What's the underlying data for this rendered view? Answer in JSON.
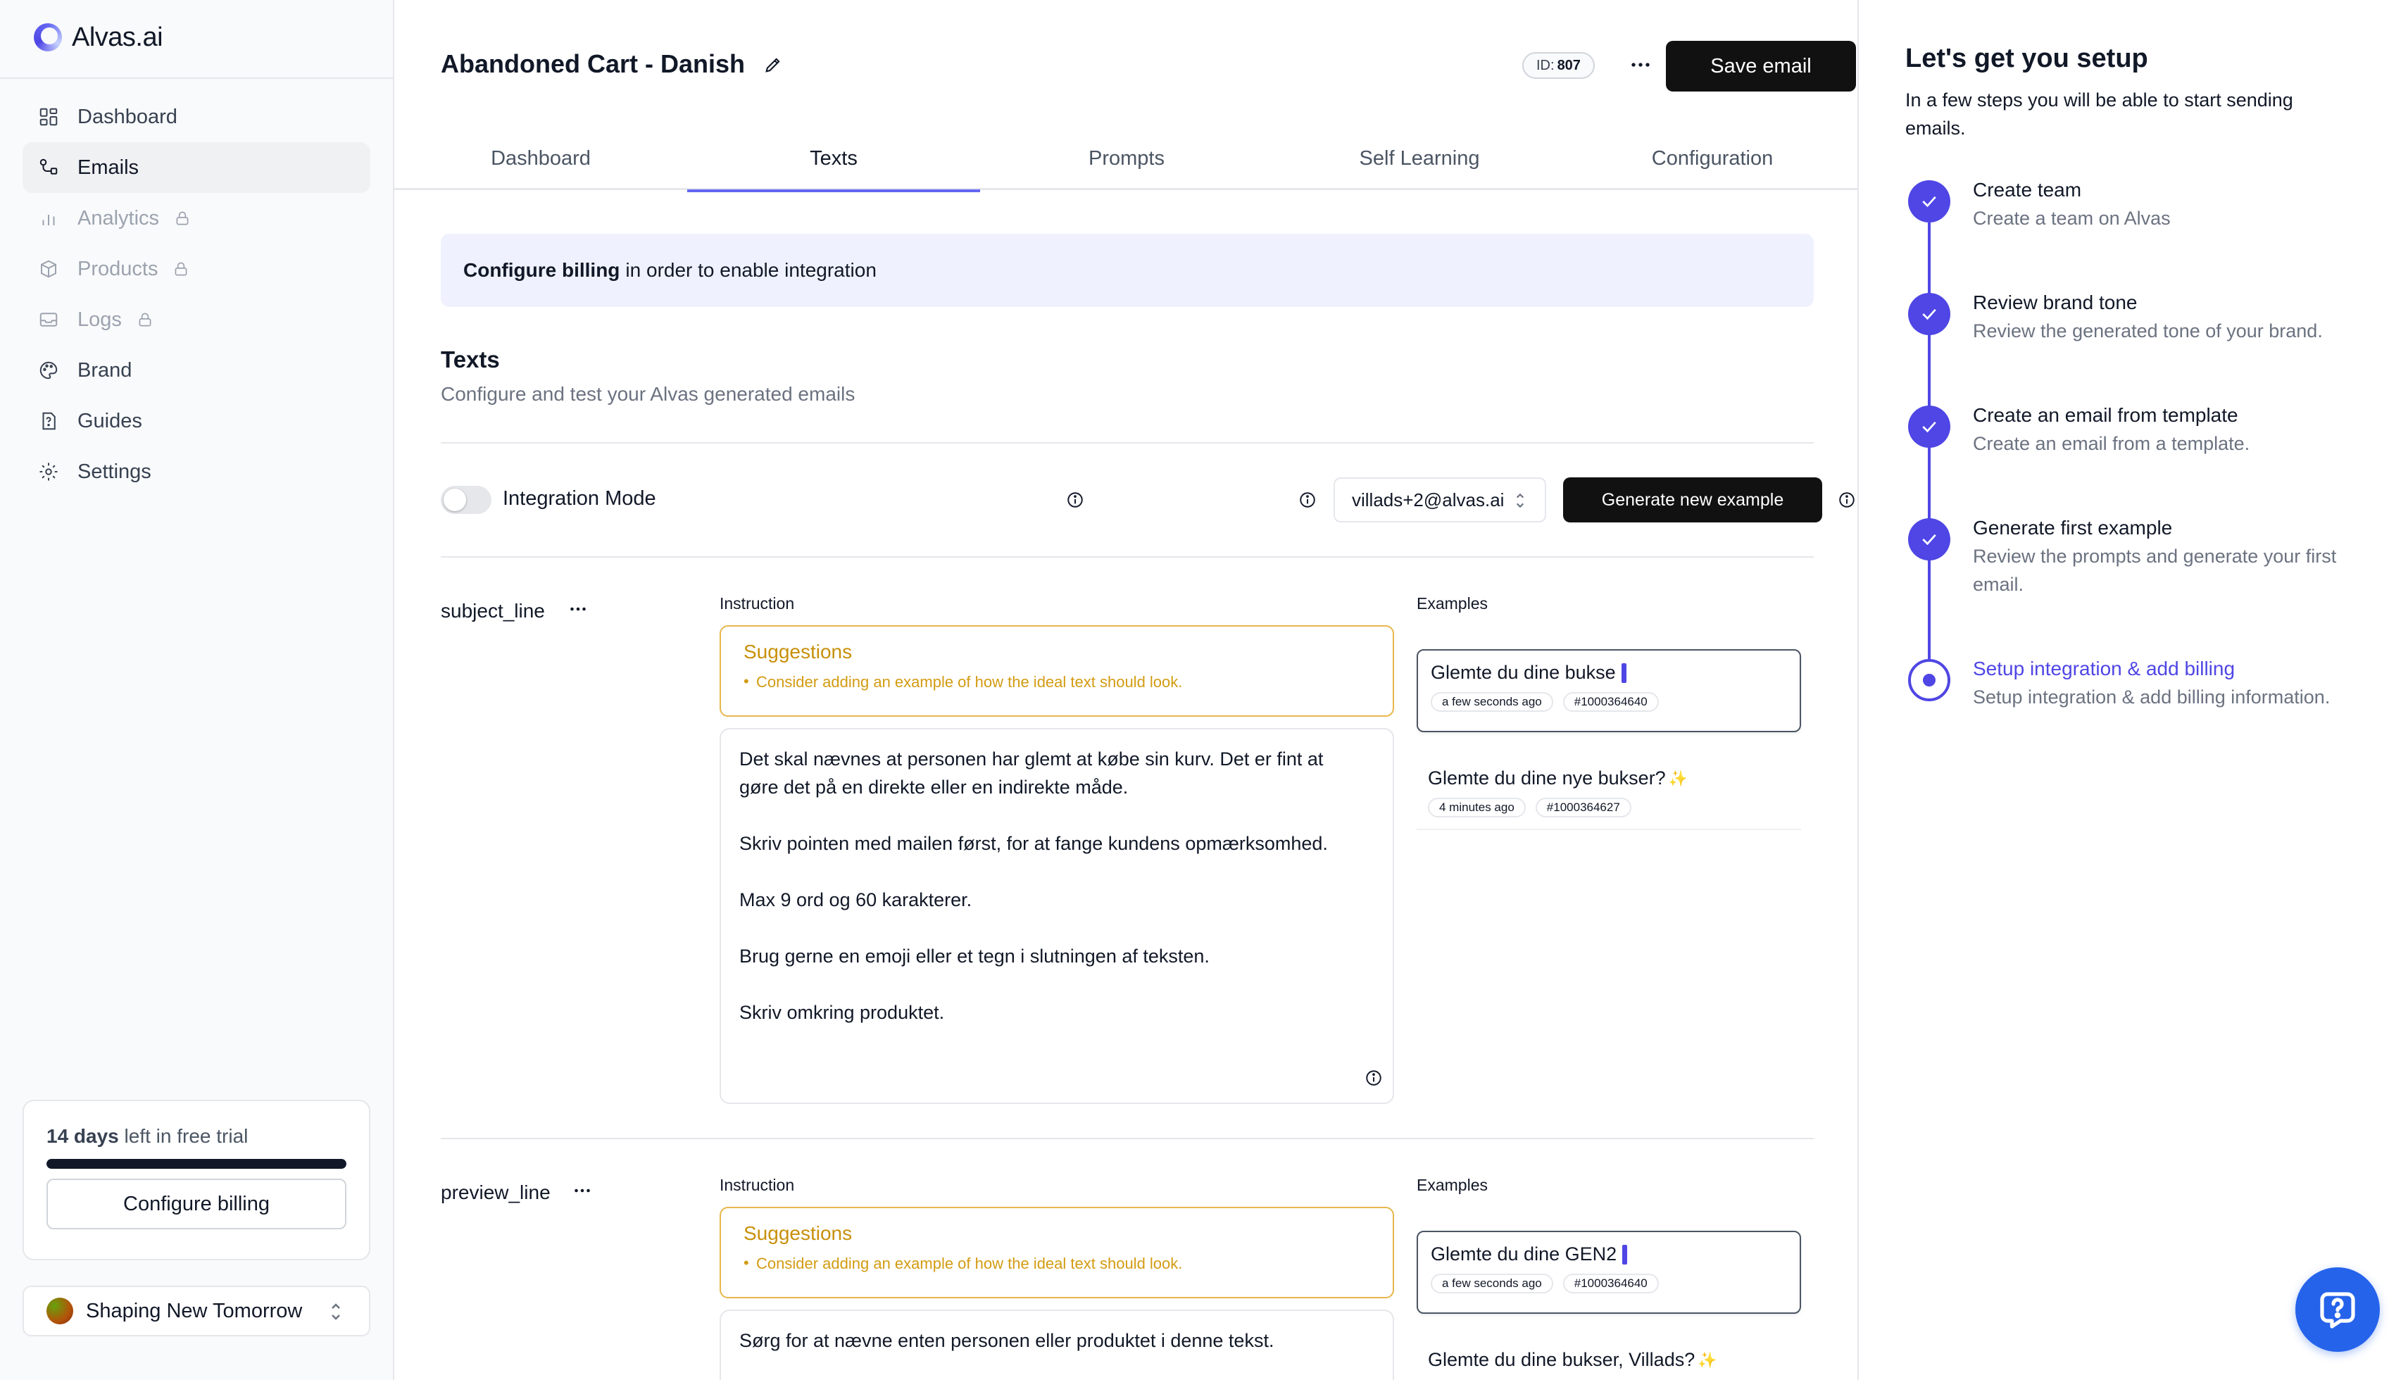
{
  "app": {
    "logo_text": "Alvas.ai"
  },
  "sidebar": {
    "items": [
      {
        "label": "Dashboard",
        "icon": "dashboard-grid-icon",
        "active": false,
        "locked": false
      },
      {
        "label": "Emails",
        "icon": "emails-icon",
        "active": true,
        "locked": false
      },
      {
        "label": "Analytics",
        "icon": "analytics-icon",
        "active": false,
        "locked": true
      },
      {
        "label": "Products",
        "icon": "products-icon",
        "active": false,
        "locked": true
      },
      {
        "label": "Logs",
        "icon": "logs-icon",
        "active": false,
        "locked": true
      },
      {
        "label": "Brand",
        "icon": "palette-icon",
        "active": false,
        "locked": false
      },
      {
        "label": "Guides",
        "icon": "guides-icon",
        "active": false,
        "locked": false
      },
      {
        "label": "Settings",
        "icon": "gear-icon",
        "active": false,
        "locked": false
      }
    ],
    "trial": {
      "days": "14 days",
      "suffix": "left in free trial",
      "progress": 1.0,
      "button": "Configure billing"
    },
    "team": {
      "name": "Shaping New Tomorrow"
    }
  },
  "header": {
    "title": "Abandoned Cart - Danish",
    "id_label": "ID:",
    "id_value": "807",
    "save_label": "Save email"
  },
  "tabs": [
    {
      "label": "Dashboard",
      "active": false
    },
    {
      "label": "Texts",
      "active": true
    },
    {
      "label": "Prompts",
      "active": false
    },
    {
      "label": "Self Learning",
      "active": false
    },
    {
      "label": "Configuration",
      "active": false
    }
  ],
  "banner": {
    "bold": "Configure billing",
    "rest": "in order to enable integration"
  },
  "texts_section": {
    "title": "Texts",
    "subtitle": "Configure and test your Alvas generated emails",
    "integration_label": "Integration Mode",
    "integration_on": false,
    "email_select": "villads+2@alvas.ai",
    "generate_label": "Generate new example",
    "instruction_label": "Instruction",
    "examples_label": "Examples",
    "suggestions_title": "Suggestions",
    "suggestion_item": "Consider adding an example of how the ideal text should look."
  },
  "fields": [
    {
      "name": "subject_line",
      "instruction_lines": [
        "Det skal nævnes at personen har glemt at købe sin kurv. Det er fint at",
        "gøre det på en direkte eller en indirekte måde.",
        "Skriv pointen med mailen først, for at fange kundens opmærksomhed.",
        "Max 9 ord og 60 karakterer.",
        "Brug gerne en emoji eller et tegn i slutningen af teksten.",
        "Skriv omkring produktet."
      ],
      "examples": [
        {
          "text": "Glemte du dine bukse",
          "time": "a few seconds ago",
          "id": "#1000364640"
        },
        {
          "text": "Glemte du dine nye bukser?",
          "time": "4 minutes ago",
          "id": "#1000364627"
        }
      ]
    },
    {
      "name": "preview_line",
      "instruction_lines": [
        "Sørg for at nævne enten personen eller produktet i denne tekst."
      ],
      "examples": [
        {
          "text": "Glemte du dine GEN2",
          "time": "a few seconds ago",
          "id": "#1000364640"
        },
        {
          "text": "Glemte du dine bukser, Villads?"
        }
      ]
    }
  ],
  "setup": {
    "title": "Let's get you setup",
    "subtitle": "In a few steps you will be able to start sending emails.",
    "steps": [
      {
        "title": "Create team",
        "desc": "Create a team on Alvas",
        "done": true
      },
      {
        "title": "Review brand tone",
        "desc": "Review the generated tone of your brand.",
        "done": true
      },
      {
        "title": "Create an email from template",
        "desc": "Create an email from a template.",
        "done": true
      },
      {
        "title": "Generate first example",
        "desc": "Review the prompts and generate your first email.",
        "done": true
      },
      {
        "title": "Setup integration & add billing",
        "desc": "Setup integration & add billing information.",
        "done": false,
        "current": true
      }
    ]
  },
  "colors": {
    "accent": "#4f46e5",
    "warning": "#e8b64c",
    "help_button": "#2563eb"
  }
}
